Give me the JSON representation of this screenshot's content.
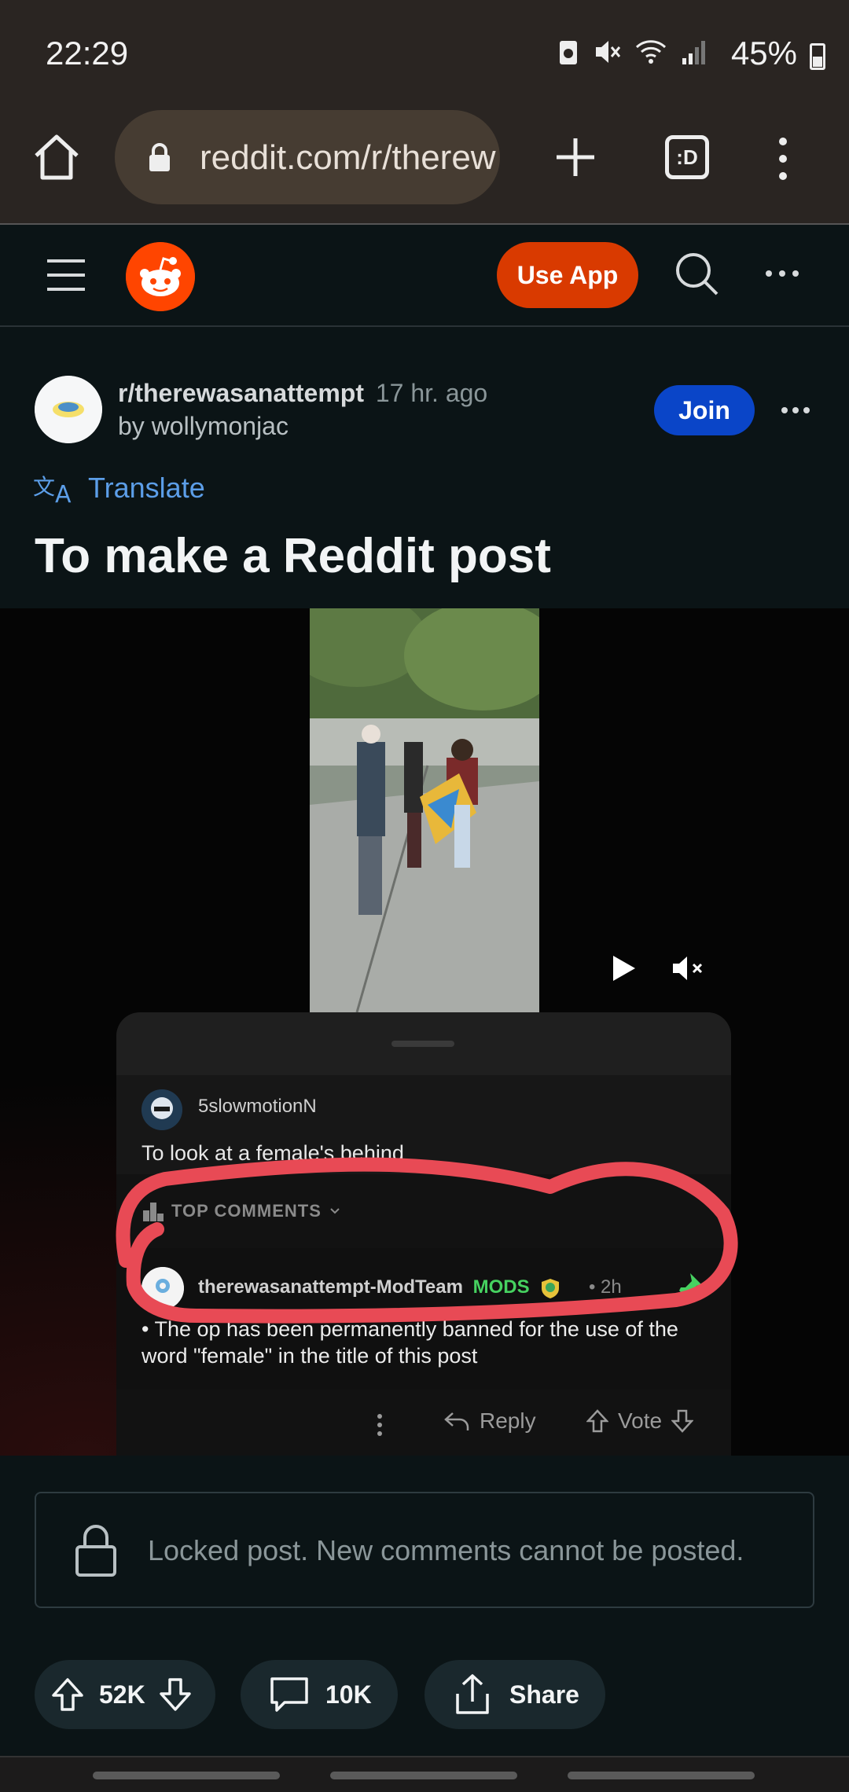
{
  "status_bar": {
    "time": "22:29",
    "battery_pct": "45%"
  },
  "browser": {
    "url": "reddit.com/r/therew",
    "tabs_label": ":D"
  },
  "reddit_header": {
    "use_app_label": "Use App"
  },
  "post": {
    "subreddit": "r/therewasanattempt",
    "posted_ago": "17 hr. ago",
    "author_line": "by wollymonjac",
    "join_label": "Join",
    "translate_label": "Translate",
    "title": "To make a Reddit post"
  },
  "embedded_screenshot": {
    "parent_user": "5slowmotionN",
    "parent_text": "To look at a female's behind",
    "top_comments_label": "TOP COMMENTS",
    "mod_user": "therewasanattempt-ModTeam",
    "mod_badge": "MODS",
    "mod_time": "• 2h",
    "mod_text": "• The op has been permanently banned  for the use of the word \"female\" in the title of this post",
    "reply_label": "Reply",
    "vote_label": "Vote",
    "annotation_color": "#e84a55"
  },
  "locked_notice": "Locked post. New comments cannot be posted.",
  "actions": {
    "votes": "52K",
    "comments": "10K",
    "share_label": "Share"
  }
}
